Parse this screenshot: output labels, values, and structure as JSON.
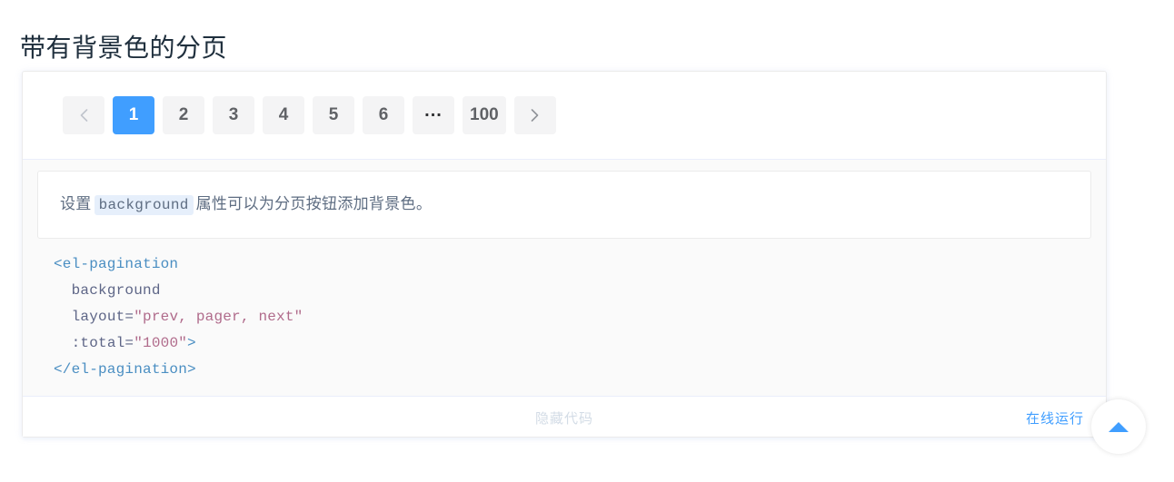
{
  "page": {
    "title": "带有背景色的分页"
  },
  "pagination": {
    "prev_icon": "chevron-left-icon",
    "next_icon": "chevron-right-icon",
    "active_page": "1",
    "active_color": "#409eff",
    "button_bg": "#f4f4f5",
    "pages": [
      "1",
      "2",
      "3",
      "4",
      "5",
      "6",
      "...",
      "100"
    ]
  },
  "description": {
    "before": "设置",
    "code": "background",
    "after": "属性可以为分页按钮添加背景色。"
  },
  "code_block": {
    "lines": [
      {
        "tag_open": "<el-pagination"
      },
      {
        "attr": "background"
      },
      {
        "attr_name": "layout=",
        "attr_value": "\"prev, pager, next\""
      },
      {
        "attr_name": ":total=",
        "attr_value": "\"1000\"",
        "tag_close": ">"
      },
      {
        "tag_end": "</el-pagination>"
      }
    ]
  },
  "footer": {
    "toggle_label": "隐藏代码",
    "run_label": "在线运行"
  },
  "back_to_top": {
    "icon": "caret-up-icon",
    "color": "#409eff"
  }
}
